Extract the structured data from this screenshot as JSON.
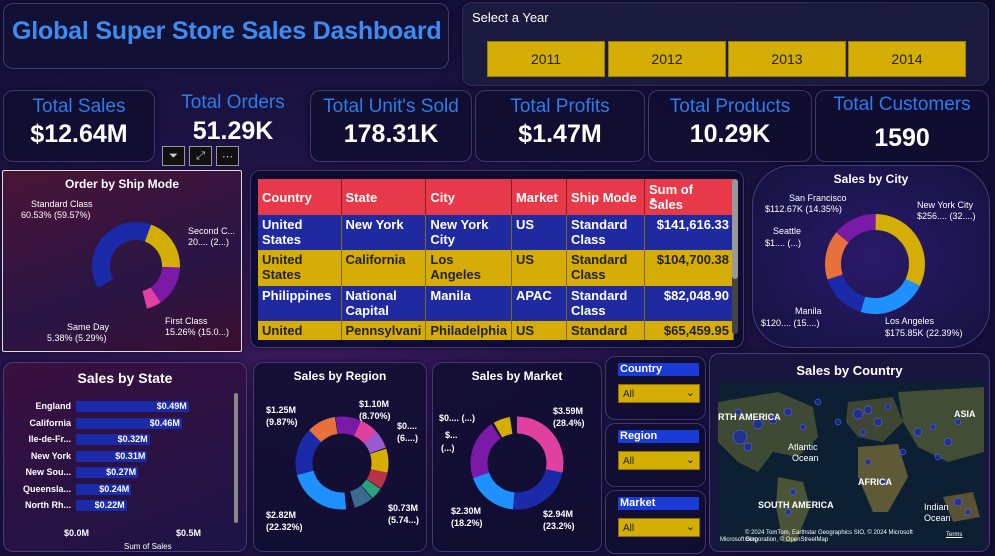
{
  "title": "Global Super Store Sales Dashboard",
  "year_slicer": {
    "label": "Select a Year",
    "years": [
      "2011",
      "2012",
      "2013",
      "2014"
    ]
  },
  "kpis": [
    {
      "label": "Total Sales",
      "value": "$12.64M"
    },
    {
      "label": "Total Orders",
      "value": "51.29K"
    },
    {
      "label": "Total Unit's Sold",
      "value": "178.31K"
    },
    {
      "label": "Total Profits",
      "value": "$1.47M"
    },
    {
      "label": "Total Products",
      "value": "10.29K"
    },
    {
      "label": "Total Customers",
      "value": "1590"
    }
  ],
  "ship_mode": {
    "title": "Order by Ship Mode",
    "labels": [
      "Standard Class",
      "60.53% (59.57%)",
      "Second C...",
      "20.... (2...)",
      "First Class",
      "15.26% (15.0...)",
      "Same Day",
      "5.38% (5.29%)"
    ],
    "colors": [
      "#1a2aa8",
      "#d4ae05",
      "#7a1aa6",
      "#e040a0"
    ]
  },
  "table": {
    "headers": [
      "Country",
      "State",
      "City",
      "Market",
      "Ship Mode",
      "Sum of Sales"
    ],
    "rows": [
      [
        "United States",
        "New York",
        "New York City",
        "US",
        "Standard Class",
        "$141,616.33"
      ],
      [
        "United States",
        "California",
        "Los Angeles",
        "US",
        "Standard Class",
        "$104,700.38"
      ],
      [
        "Philippines",
        "National Capital",
        "Manila",
        "APAC",
        "Standard Class",
        "$82,048.90"
      ],
      [
        "United",
        "Pennsylvani",
        "Philadelphia",
        "US",
        "Standard",
        "$65,459.95"
      ]
    ]
  },
  "city": {
    "title": "Sales by City",
    "labels": [
      "San Francisco",
      "$112.67K (14.35%)",
      "New York City",
      "$256.... (32....)",
      "Seattle",
      "$1.... (...)",
      "Manila",
      "$120.... (15....)",
      "Los Angeles",
      "$175.85K (22.39%)"
    ]
  },
  "state": {
    "title": "Sales by State",
    "axis_min": "$0.0M",
    "axis_max": "$0.5M",
    "axis_title": "Sum of Sales",
    "items": [
      {
        "name": "England",
        "value": "$0.49M",
        "v": 0.49
      },
      {
        "name": "California",
        "value": "$0.46M",
        "v": 0.46
      },
      {
        "name": "Ile-de-Fr...",
        "value": "$0.32M",
        "v": 0.32
      },
      {
        "name": "New York",
        "value": "$0.31M",
        "v": 0.31
      },
      {
        "name": "New Sou...",
        "value": "$0.27M",
        "v": 0.27
      },
      {
        "name": "Queensla...",
        "value": "$0.24M",
        "v": 0.24
      },
      {
        "name": "North Rh...",
        "value": "$0.22M",
        "v": 0.22
      }
    ]
  },
  "region": {
    "title": "Sales by Region",
    "labels": [
      "$1.25M",
      "(9.87%)",
      "$1.10M",
      "(8.70%)",
      "$0....",
      "(6....)",
      "$0.73M",
      "(5.74...)",
      "$2.82M",
      "(22.32%)"
    ]
  },
  "market": {
    "title": "Sales by Market",
    "labels": [
      "$0.... (...)",
      "$...",
      "(...)",
      "$3.59M",
      "(28.4%)",
      "$2.30M",
      "(18.2%)",
      "$2.94M",
      "(23.2%)"
    ]
  },
  "slicers": [
    {
      "label": "Country",
      "value": "All"
    },
    {
      "label": "Region",
      "value": "All"
    },
    {
      "label": "Market",
      "value": "All"
    }
  ],
  "map": {
    "title": "Sales by Country",
    "places": [
      "RTH AMERICA",
      "Atlantic",
      "Ocean",
      "ASIA",
      "AFRICA",
      "SOUTH AMERICA",
      "Indian",
      "Ocean"
    ],
    "copyright": "© 2024 TomTom, Earthstar Geographics SIO, © 2024 Microsoft Corporation, © OpenStreetMap",
    "terms": "Terms",
    "brand": "Microsoft Bing"
  }
}
